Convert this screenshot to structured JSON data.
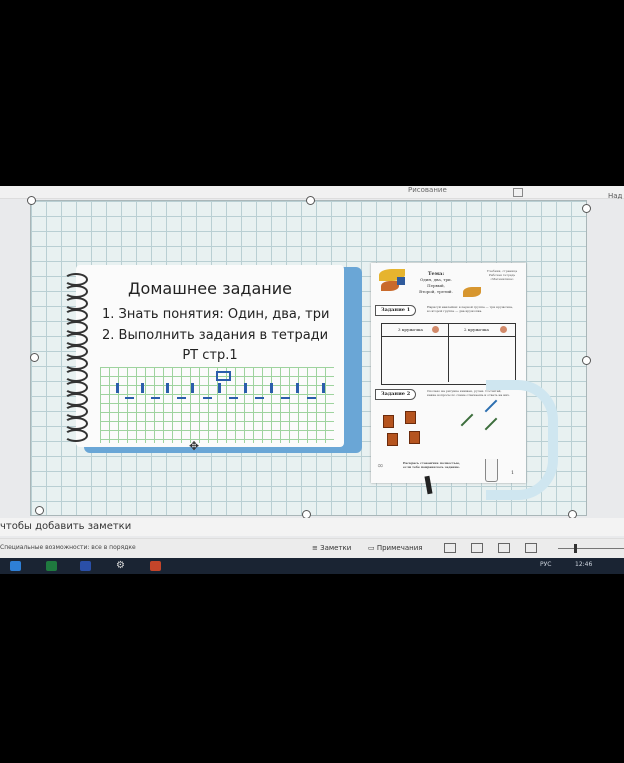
{
  "ribbon": {
    "label": "Рисование",
    "right_label": "Над"
  },
  "slide": {
    "homework_title": "Домашнее задание",
    "item1": "1. Знать понятия: Один, два, три",
    "item2": "2. Выполнить задания в тетради",
    "item3": "РТ стр.1"
  },
  "worksheet": {
    "topic_title": "Тема:",
    "topic_lines": [
      "Один, два, три. Первый,",
      "Второй, третий."
    ],
    "corner_lines": [
      "Учебник, страница",
      "Рабочая тетрадь",
      "«Математика»"
    ],
    "task1_label": "Задание 1",
    "task1_text": [
      "Нарисуй наклейки: в первой группе — три кружочка,",
      "во второй группе — два кружочка."
    ],
    "col1_header": "3 кружочка",
    "col2_header": "2 кружочка",
    "task2_label": "Задание 2",
    "task2_text": [
      "Сколько на рисунке книжек, ручек. Сосчитай,",
      "какие вопросы по схеме отвечаешь и ответь на них."
    ],
    "bottom_text": [
      "Раскрась стаканчик полностью,",
      "если тебе понравилось задание."
    ],
    "page_number": "1"
  },
  "notes_placeholder": "чтобы добавить заметки",
  "status": {
    "accessibility": "Специальные возможности: все в порядке",
    "notes_button": "Заметки",
    "comments_button": "Примечания"
  },
  "taskbar": {
    "clock": "12:46",
    "lang": "РУС"
  }
}
